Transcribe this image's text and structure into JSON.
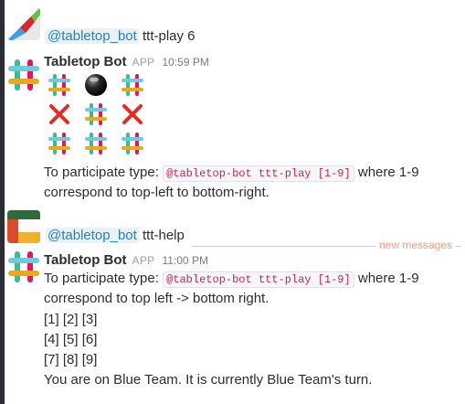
{
  "colors": {
    "accent_link": "#2a80b9",
    "code_text": "#c7254e",
    "new_messages": "#f39c83",
    "x_red": "#e32d22"
  },
  "messages": [
    {
      "mention": "@tabletop_bot",
      "text": " ttt-play 6"
    },
    {
      "author": "Tabletop Bot",
      "badge": "APP",
      "time": "10:59 PM",
      "board": [
        [
          "slack-icon",
          "ball-icon",
          "slack-icon"
        ],
        [
          "x-icon",
          "slack-icon",
          "x-icon"
        ],
        [
          "slack-icon",
          "slack-icon",
          "slack-icon"
        ]
      ],
      "line1_prefix": "To participate type: ",
      "line1_code": "@tabletop-bot ttt-play [1-9]",
      "line1_suffix": " where 1-9",
      "line2": "correspond to top-left to bottom-right."
    },
    {
      "mention": "@tabletop_bot",
      "text": " ttt-help"
    },
    {
      "author": "Tabletop Bot",
      "badge": "APP",
      "time": "11:00 PM",
      "line1_prefix": "To participate type: ",
      "line1_code": "@tabletop-bot ttt-play [1-9]",
      "line1_suffix": " where 1-9",
      "line2": "correspond to top left -> bottom right.",
      "rows": [
        "[1] [2] [3]",
        "[4] [5] [6]",
        "[7] [8] [9]"
      ],
      "status": "You are on Blue Team. It is currently Blue Team's turn."
    }
  ],
  "divider": {
    "label": "new messages"
  }
}
